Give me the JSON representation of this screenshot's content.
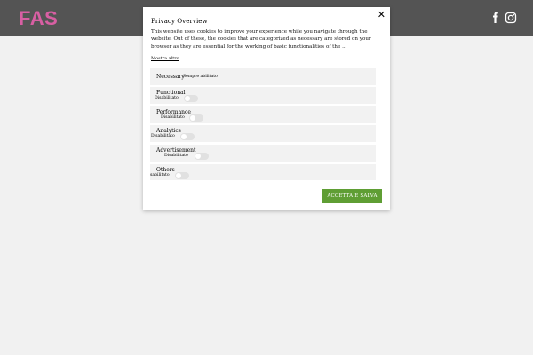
{
  "site": {
    "logo": "FAS"
  },
  "social": {
    "icons": [
      "facebook-icon",
      "instagram-icon"
    ]
  },
  "modal": {
    "close_label": "✕",
    "title": "Privacy Overview",
    "description": "This website uses cookies to improve your experience while you navigate through the website. Out of these, the cookies that are categorized as necessary are stored on your browser as they are essential for the working of basic functionalities of the ...",
    "show_more": "Mostra altro",
    "categories": [
      {
        "name": "Necessary",
        "status": "Sempre abilitato"
      },
      {
        "name": "Functional",
        "status": "Disabilitato"
      },
      {
        "name": "Performance",
        "status": "Disabilitato"
      },
      {
        "name": "Analytics",
        "status": "Disabilitato"
      },
      {
        "name": "Advertisement",
        "status": "Disabilitato"
      },
      {
        "name": "Others",
        "status": "sabilitato"
      }
    ],
    "accept_label": "ACCETTA E SALVA"
  },
  "colors": {
    "topbar": "#545454",
    "logo": "#d85fa3",
    "accept": "#5f9e34"
  }
}
